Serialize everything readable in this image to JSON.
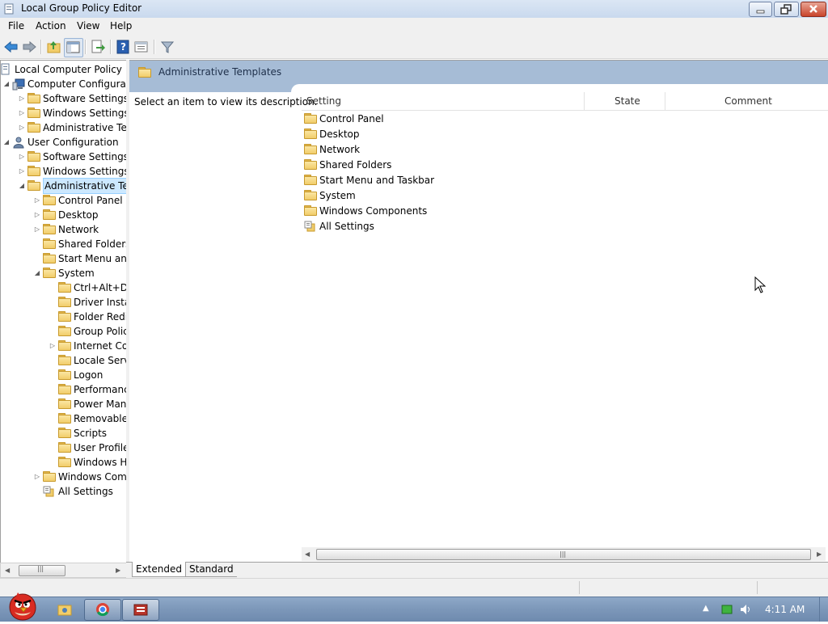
{
  "window": {
    "title": "Local Group Policy Editor"
  },
  "menu": [
    "File",
    "Action",
    "View",
    "Help"
  ],
  "tree": [
    {
      "label": "Local Computer Policy",
      "expander": "",
      "icon": "computer-policy-icon"
    },
    {
      "label": "Computer Configuratio",
      "expander": "◢",
      "icon": "computer-icon"
    },
    {
      "label": "Software Settings",
      "expander": "▷",
      "icon": "folder-icon"
    },
    {
      "label": "Windows Settings",
      "expander": "▷",
      "icon": "folder-icon"
    },
    {
      "label": "Administrative Tem",
      "expander": "▷",
      "icon": "folder-icon"
    },
    {
      "label": "User Configuration",
      "expander": "◢",
      "icon": "user-icon"
    },
    {
      "label": "Software Settings",
      "expander": "▷",
      "icon": "folder-icon"
    },
    {
      "label": "Windows Settings",
      "expander": "▷",
      "icon": "folder-icon"
    },
    {
      "label": "Administrative Tem",
      "expander": "◢",
      "icon": "folder-icon"
    },
    {
      "label": "Control Panel",
      "expander": "▷",
      "icon": "folder-icon"
    },
    {
      "label": "Desktop",
      "expander": "▷",
      "icon": "folder-icon"
    },
    {
      "label": "Network",
      "expander": "▷",
      "icon": "folder-icon"
    },
    {
      "label": "Shared Folders",
      "expander": "",
      "icon": "folder-icon"
    },
    {
      "label": "Start Menu and",
      "expander": "",
      "icon": "folder-icon"
    },
    {
      "label": "System",
      "expander": "◢",
      "icon": "folder-icon"
    },
    {
      "label": "Ctrl+Alt+De",
      "expander": "",
      "icon": "folder-icon"
    },
    {
      "label": "Driver Instal",
      "expander": "",
      "icon": "folder-icon"
    },
    {
      "label": "Folder Redir",
      "expander": "",
      "icon": "folder-icon"
    },
    {
      "label": "Group Polic",
      "expander": "",
      "icon": "folder-icon"
    },
    {
      "label": "Internet Cor",
      "expander": "▷",
      "icon": "folder-icon"
    },
    {
      "label": "Locale Servi",
      "expander": "",
      "icon": "folder-icon"
    },
    {
      "label": "Logon",
      "expander": "",
      "icon": "folder-icon"
    },
    {
      "label": "Performanc",
      "expander": "",
      "icon": "folder-icon"
    },
    {
      "label": "Power Mana",
      "expander": "",
      "icon": "folder-icon"
    },
    {
      "label": "Removable",
      "expander": "",
      "icon": "folder-icon"
    },
    {
      "label": "Scripts",
      "expander": "",
      "icon": "folder-icon"
    },
    {
      "label": "User Profile:",
      "expander": "",
      "icon": "folder-icon"
    },
    {
      "label": "Windows H",
      "expander": "",
      "icon": "folder-icon"
    },
    {
      "label": "Windows Comp",
      "expander": "▷",
      "icon": "folder-icon"
    },
    {
      "label": "All Settings",
      "expander": "",
      "icon": "all-settings-icon"
    }
  ],
  "right": {
    "header": "Administrative Templates",
    "description": "Select an item to view its description.",
    "columns": [
      "Setting",
      "State",
      "Comment"
    ],
    "items": [
      "Control Panel",
      "Desktop",
      "Network",
      "Shared Folders",
      "Start Menu and Taskbar",
      "System",
      "Windows Components",
      "All Settings"
    ]
  },
  "tabs": [
    "Extended",
    "Standard"
  ],
  "taskbar": {
    "clock": "4:11 AM"
  }
}
